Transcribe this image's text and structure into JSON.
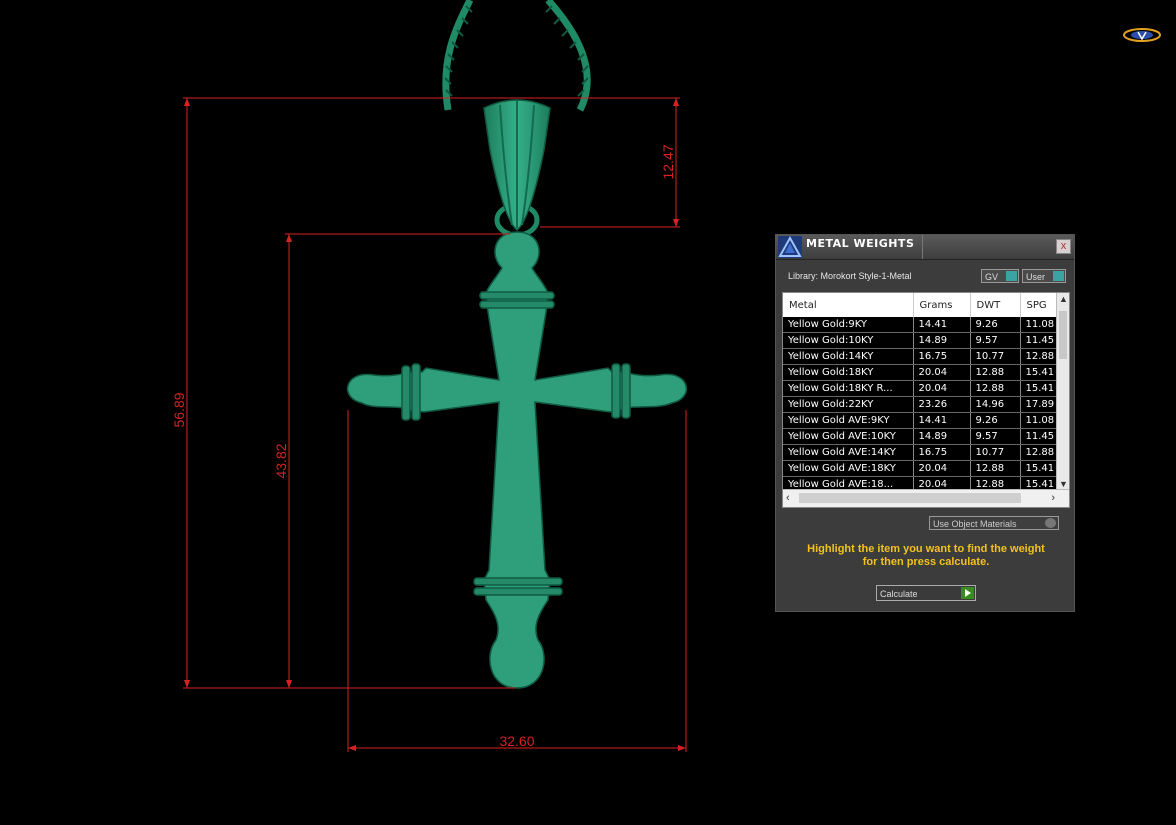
{
  "dimensions": {
    "total_height": "56.89",
    "body_height": "43.82",
    "bail_height": "12.47",
    "width": "32.60"
  },
  "panel": {
    "title": "METAL WEIGHTS",
    "close": "x",
    "library_label": "Library: Morokort Style-1-Metal",
    "gv_button": "GV",
    "user_button": "User",
    "columns": [
      "Metal",
      "Grams",
      "DWT",
      "SPG"
    ],
    "rows": [
      [
        "Yellow Gold:9KY",
        "14.41",
        "9.26",
        "11.08"
      ],
      [
        "Yellow Gold:10KY",
        "14.89",
        "9.57",
        "11.45"
      ],
      [
        "Yellow Gold:14KY",
        "16.75",
        "10.77",
        "12.88"
      ],
      [
        "Yellow Gold:18KY",
        "20.04",
        "12.88",
        "15.41"
      ],
      [
        "Yellow Gold:18KY R...",
        "20.04",
        "12.88",
        "15.41"
      ],
      [
        "Yellow Gold:22KY",
        "23.26",
        "14.96",
        "17.89"
      ],
      [
        "Yellow Gold AVE:9KY",
        "14.41",
        "9.26",
        "11.08"
      ],
      [
        "Yellow Gold AVE:10KY",
        "14.89",
        "9.57",
        "11.45"
      ],
      [
        "Yellow Gold AVE:14KY",
        "16.75",
        "10.77",
        "12.88"
      ],
      [
        "Yellow Gold AVE:18KY",
        "20.04",
        "12.88",
        "15.41"
      ],
      [
        "Yellow Gold AVE:18...",
        "20.04",
        "12.88",
        "15.41"
      ]
    ],
    "use_object_materials": "Use Object Materials",
    "instruction_line1": "Highlight the item you want to find the weight",
    "instruction_line2": "for then press calculate.",
    "calculate_button": "Calculate"
  },
  "colors": {
    "model": "#2f9e7a",
    "dimension_lines": "#d62222",
    "instruction_text": "#f2c21e",
    "background": "#000000"
  }
}
